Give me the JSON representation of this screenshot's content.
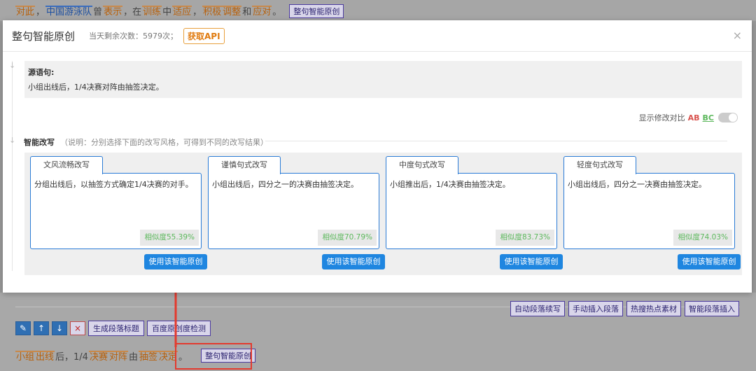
{
  "background": {
    "top_tokens": [
      {
        "text": "对此",
        "style": "o"
      },
      {
        "text": "，",
        "style": ""
      },
      {
        "text": "中国游泳队",
        "style": "b"
      },
      {
        "text": "曾",
        "style": ""
      },
      {
        "text": "表示",
        "style": "o"
      },
      {
        "text": "，在",
        "style": ""
      },
      {
        "text": "训练",
        "style": "o"
      },
      {
        "text": "中",
        "style": ""
      },
      {
        "text": "适应",
        "style": "o"
      },
      {
        "text": "，",
        "style": ""
      },
      {
        "text": "积极",
        "style": "o"
      },
      {
        "text": "调整",
        "style": "o"
      },
      {
        "text": "和",
        "style": ""
      },
      {
        "text": "应对",
        "style": "o"
      },
      {
        "text": "。",
        "style": ""
      }
    ],
    "top_button": "整句智能原创",
    "right_tools": [
      "自动段落续写",
      "手动插入段落",
      "热搜热点素材",
      "智能段落插入"
    ],
    "left_tool_icons": [
      "pencil-icon",
      "arrow-up-icon",
      "arrow-down-icon",
      "close-icon"
    ],
    "left_tool_glyphs": [
      "✎",
      "↑",
      "↓",
      "×"
    ],
    "left_tool_labels": [
      "生成段落标题",
      "百度原创度检测"
    ],
    "bottom_tokens": [
      {
        "text": "小组",
        "style": "o"
      },
      {
        "text": "出线",
        "style": "o"
      },
      {
        "text": "后，1/4",
        "style": ""
      },
      {
        "text": "决赛",
        "style": "o"
      },
      {
        "text": "对阵",
        "style": "o"
      },
      {
        "text": "由",
        "style": ""
      },
      {
        "text": "抽签",
        "style": "o"
      },
      {
        "text": "决定",
        "style": "o"
      },
      {
        "text": "。",
        "style": ""
      }
    ],
    "bottom_button": "整句智能原创"
  },
  "modal": {
    "title": "整句智能原创",
    "quota": "当天剩余次数：5979次；",
    "api_button": "获取API",
    "close_glyph": "×",
    "source_label": "源语句:",
    "source_text": "小组出线后，1/4决赛对阵由抽签决定。",
    "toggle_label": "显示修改对比",
    "toggle_ab": "AB",
    "toggle_bc": "BC",
    "ai_label": "智能改写",
    "ai_note": "（说明：分别选择下面的改写风格，可得到不同的改写结果）",
    "use_button": "使用该智能原创",
    "cards": [
      {
        "tab": "文风流畅改写",
        "text": "分组出线后，以抽签方式确定1/4决赛的对手。",
        "similarity": "相似度55.39%"
      },
      {
        "tab": "谨慎句式改写",
        "text": "小组出线后，四分之一的决赛由抽签决定。",
        "similarity": "相似度70.79%"
      },
      {
        "tab": "中度句式改写",
        "text": "小组推出后，1/4决赛由抽签决定。",
        "similarity": "相似度83.73%"
      },
      {
        "tab": "轻度句式改写",
        "text": "小组出线后，四分之一决赛由抽签决定。",
        "similarity": "相似度74.03%"
      }
    ]
  },
  "colors": {
    "accent": "#1f86e0",
    "highlight_orange": "#c9894a",
    "highlight_blue": "#3a6dbf",
    "annotation_red": "#e33a2e",
    "similarity_green": "#5cb85c"
  }
}
